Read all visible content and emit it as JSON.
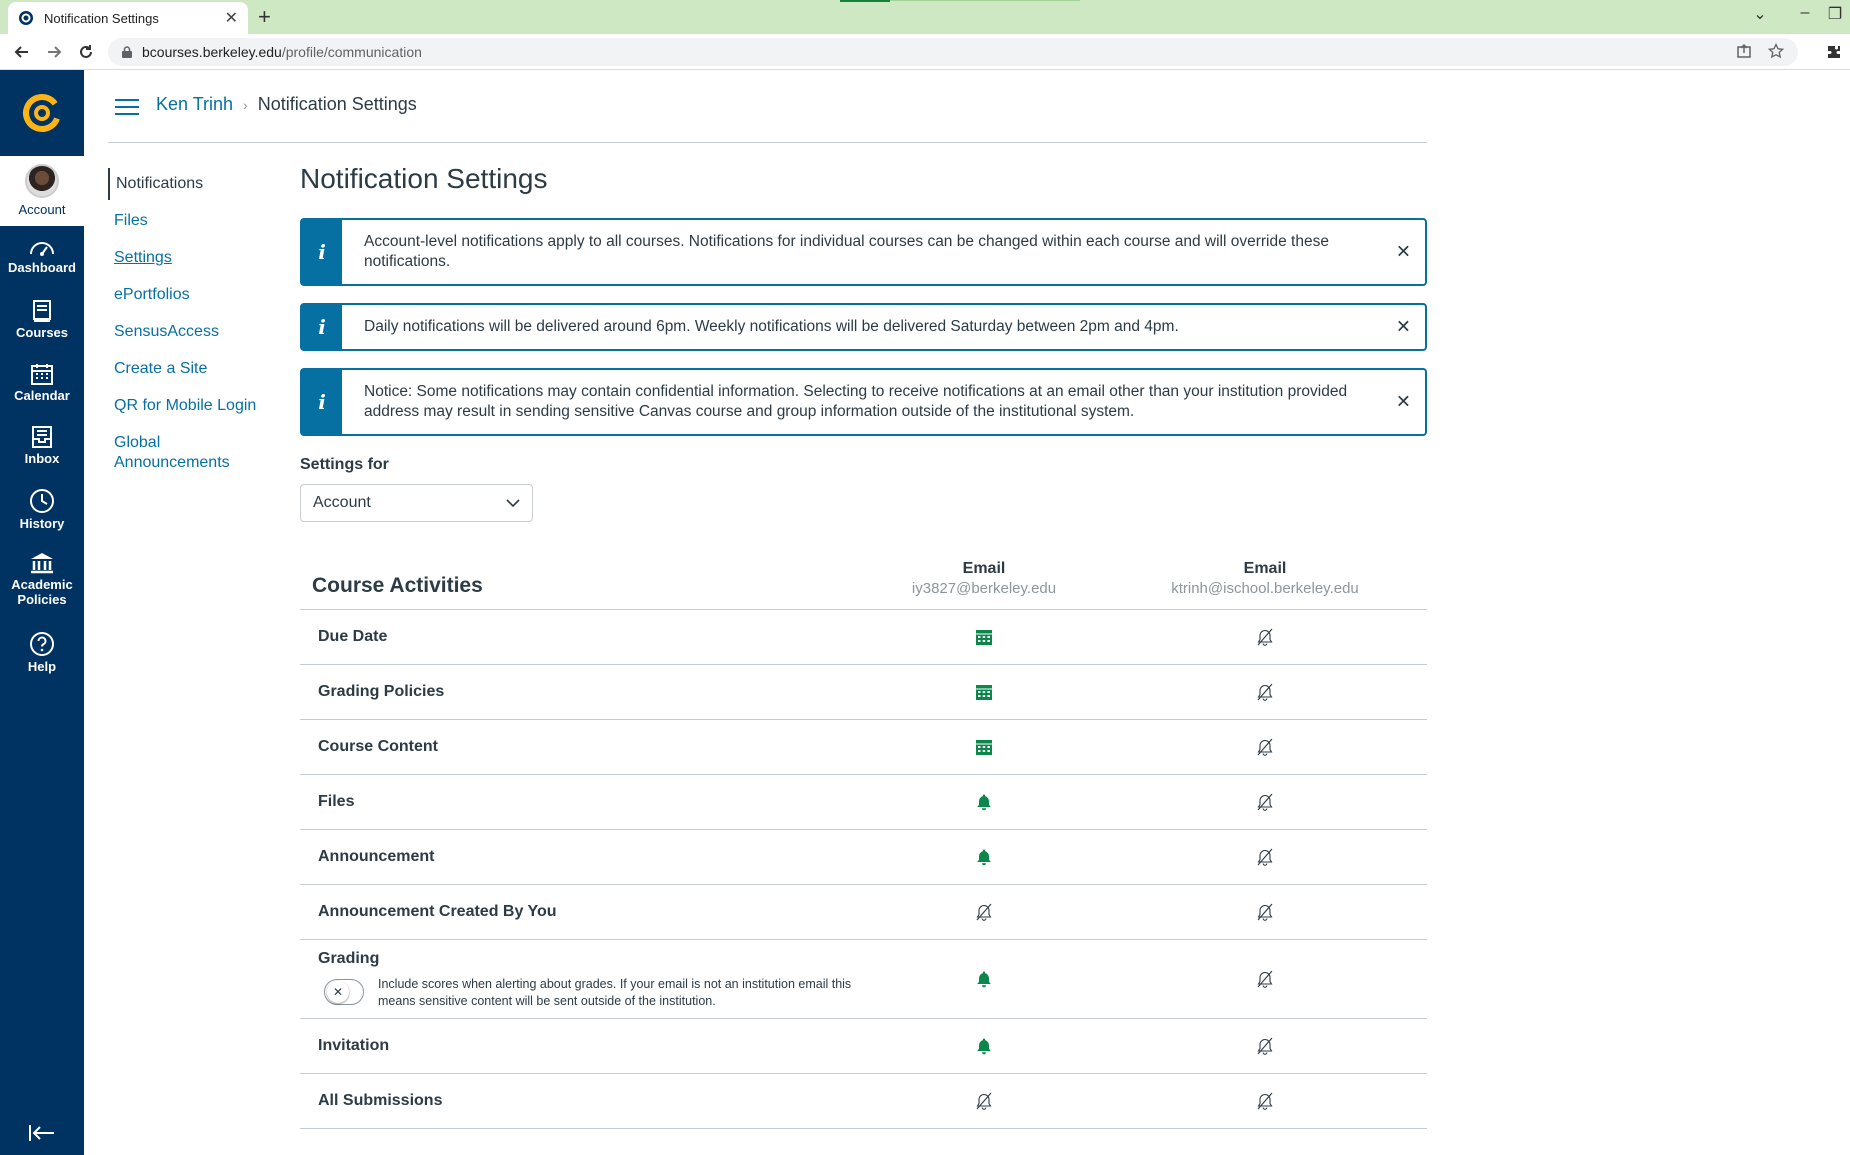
{
  "browser": {
    "tab_title": "Notification Settings",
    "url_host": "bcourses.berkeley.edu",
    "url_path": "/profile/communication"
  },
  "globalnav": {
    "account": "Account",
    "items": [
      {
        "label": "Dashboard",
        "icon": "dashboard-icon"
      },
      {
        "label": "Courses",
        "icon": "courses-icon"
      },
      {
        "label": "Calendar",
        "icon": "calendar-icon"
      },
      {
        "label": "Inbox",
        "icon": "inbox-icon"
      },
      {
        "label": "History",
        "icon": "history-icon"
      },
      {
        "label": "Academic Policies",
        "icon": "academic-policies-icon"
      },
      {
        "label": "Help",
        "icon": "help-icon"
      }
    ]
  },
  "header": {
    "breadcrumb_user": "Ken Trinh",
    "breadcrumb_current": "Notification Settings"
  },
  "subnav": {
    "items": [
      "Notifications",
      "Files",
      "Settings",
      "ePortfolios",
      "SensusAccess",
      "Create a Site",
      "QR for Mobile Login",
      "Global Announcements"
    ]
  },
  "main": {
    "title": "Notification Settings",
    "alerts": [
      "Account-level notifications apply to all courses. Notifications for individual courses can be changed within each course and will override these notifications.",
      "Daily notifications will be delivered around 6pm. Weekly notifications will be delivered Saturday between 2pm and 4pm.",
      "Notice: Some notifications may contain confidential information. Selecting to receive notifications at an email other than your institution provided address may result in sending sensitive Canvas course and group information outside of the institutional system."
    ],
    "settings_for_label": "Settings for",
    "settings_for_value": "Account"
  },
  "table": {
    "title": "Course Activities",
    "columns": [
      {
        "label": "Email",
        "address": "iy3827@berkeley.edu"
      },
      {
        "label": "Email",
        "address": "ktrinh@ischool.berkeley.edu"
      }
    ],
    "rows": [
      {
        "label": "Due Date",
        "col1": "daily",
        "col2": "off"
      },
      {
        "label": "Grading Policies",
        "col1": "daily",
        "col2": "off"
      },
      {
        "label": "Course Content",
        "col1": "daily",
        "col2": "off"
      },
      {
        "label": "Files",
        "col1": "immediately",
        "col2": "off"
      },
      {
        "label": "Announcement",
        "col1": "immediately",
        "col2": "off"
      },
      {
        "label": "Announcement Created By You",
        "col1": "off",
        "col2": "off"
      },
      {
        "label": "Grading",
        "col1": "immediately",
        "col2": "off"
      },
      {
        "label": "Invitation",
        "col1": "immediately",
        "col2": "off"
      },
      {
        "label": "All Submissions",
        "col1": "off",
        "col2": "off"
      }
    ],
    "grading_toggle_text": "Include scores when alerting about grades. If your email is not an institution email this means sensitive content will be sent outside of the institution.",
    "colors": {
      "on": "#0b874b",
      "off": "#2d3b45"
    }
  }
}
